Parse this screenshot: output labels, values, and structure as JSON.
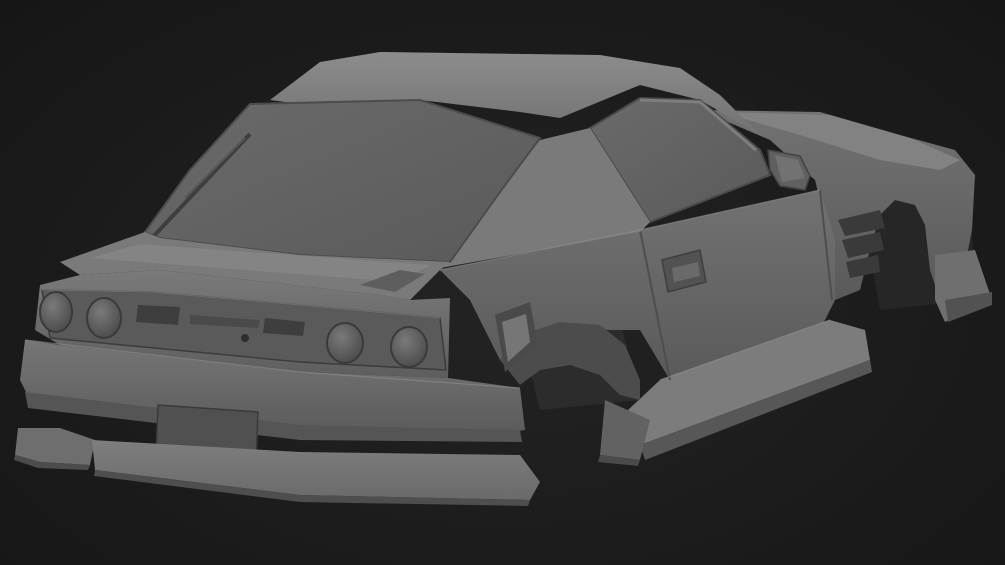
{
  "scene": {
    "subject": "car-body-3d-model",
    "colors": {
      "background": "#1b1b1b",
      "body_base": "#6e6e6e",
      "body_light": "#8a8a8a",
      "body_dark": "#4a4a4a",
      "glass": "#5c5c5c",
      "shadow": "#2e2e2e"
    }
  }
}
